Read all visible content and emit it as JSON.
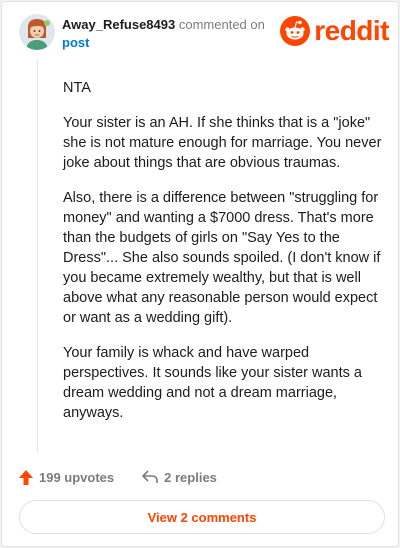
{
  "header": {
    "username": "Away_Refuse8493",
    "commented_on": "commented on",
    "post_link": "post",
    "logo_text": "reddit",
    "brand_color": "#ff4500"
  },
  "comment": {
    "paragraphs": [
      "NTA",
      "Your sister is an AH. If she thinks that is a \"joke\" she is not mature enough for marriage. You never joke about things that are obvious traumas.",
      "Also, there is a difference between \"struggling for money\" and wanting a $7000 dress. That's more than the budgets of girls on \"Say Yes to the Dress\"... She also sounds spoiled. (I don't know if you became extremely wealthy, but that is well above what any reasonable person would expect or want as a wedding gift).",
      "Your family is whack and have warped perspectives. It sounds like your sister wants a dream wedding and not a dream marriage, anyways."
    ]
  },
  "actions": {
    "upvotes": "199 upvotes",
    "replies": "2 replies"
  },
  "footer": {
    "view_comments": "View 2 comments"
  },
  "icons": {
    "upvote": "upvote-arrow-icon",
    "reply": "reply-arrow-icon",
    "logo": "reddit-snoo-icon",
    "avatar": "user-avatar"
  }
}
